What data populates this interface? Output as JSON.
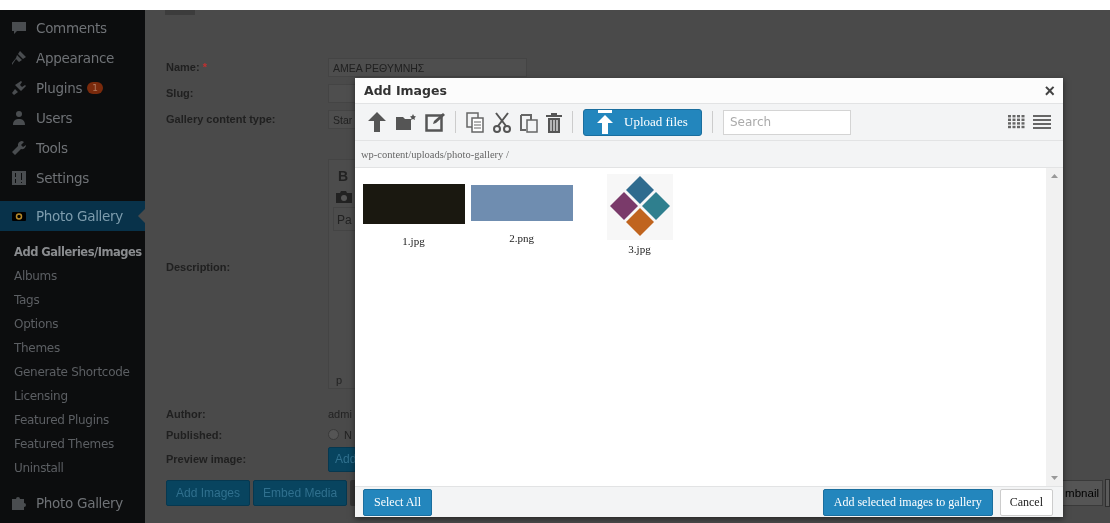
{
  "sidebar": {
    "items": [
      {
        "label": "Comments",
        "selected": false
      },
      {
        "label": "Appearance",
        "selected": false
      },
      {
        "label": "Plugins",
        "badge": "1",
        "selected": false
      },
      {
        "label": "Users",
        "selected": false
      },
      {
        "label": "Tools",
        "selected": false
      },
      {
        "label": "Settings",
        "selected": false
      },
      {
        "label": "Photo Gallery",
        "selected": true
      }
    ],
    "submenu": [
      {
        "label": "Add Galleries/Images",
        "selected": true
      },
      {
        "label": "Albums",
        "selected": false
      },
      {
        "label": "Tags",
        "selected": false
      },
      {
        "label": "Options",
        "selected": false
      },
      {
        "label": "Themes",
        "selected": false
      },
      {
        "label": "Generate Shortcode",
        "selected": false
      },
      {
        "label": "Licensing",
        "selected": false
      },
      {
        "label": "Featured Plugins",
        "selected": false
      },
      {
        "label": "Featured Themes",
        "selected": false
      },
      {
        "label": "Uninstall",
        "selected": false
      }
    ],
    "bottom_item": {
      "label": "Photo Gallery"
    }
  },
  "form": {
    "fields": [
      {
        "label": "Name:",
        "required_mark": "*",
        "value": "ΑΜΕΑ ΡΕΘΥΜΝΗΣ"
      },
      {
        "label": "Slug:"
      },
      {
        "label": "Gallery content type:",
        "value": "Star"
      }
    ],
    "description": {
      "label": "Description:",
      "bold_button": "B",
      "format": "Pa",
      "path": "p"
    },
    "author": {
      "label": "Author:",
      "value": "admi"
    },
    "published": {
      "label": "Published:",
      "option": "N",
      "checked": false
    },
    "preview": {
      "label": "Preview image:",
      "button": "Add"
    },
    "buttons": [
      "Add Images",
      "Embed Media"
    ],
    "right_button": "mbnail"
  },
  "dialog": {
    "title": "Add Images",
    "close": "×",
    "upload_button": "Upload files",
    "search": {
      "placeholder": "Search"
    },
    "path": "wp-content/uploads/photo-gallery /",
    "files": [
      {
        "name": "1.jpg",
        "kind": "night-photo",
        "selected": false
      },
      {
        "name": "2.png",
        "kind": "harbor-photo",
        "selected": false
      },
      {
        "name": "3.jpg",
        "kind": "logo",
        "selected": false
      }
    ],
    "select_all": "Select All",
    "add_button": "Add selected images to gallery",
    "cancel": "Cancel"
  }
}
